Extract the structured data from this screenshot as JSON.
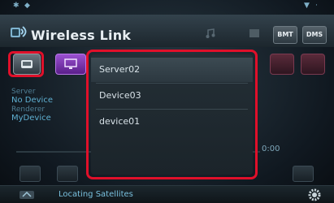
{
  "header": {
    "title": "Wireless Link",
    "btn_bmt": "BMT",
    "btn_dms": "DMS"
  },
  "info": {
    "server_label": "Server",
    "server_value": "No Device",
    "renderer_label": "Renderer",
    "renderer_value": "MyDevice"
  },
  "playback": {
    "time_right": "0:00"
  },
  "device_list": {
    "items": [
      {
        "label": "Server02"
      },
      {
        "label": "Device03"
      },
      {
        "label": "device01"
      }
    ]
  },
  "status_bar": {
    "message": "Locating Satellites"
  },
  "colors": {
    "highlight": "#e0102a",
    "accent_purple": "#9a50d0",
    "text_blue": "#5fb0d2"
  },
  "icons": {
    "app": "wireless-link-icon",
    "device_tab": "device-icon",
    "screen_tab": "monitor-icon",
    "settings": "gear-icon",
    "bottom_left": "navigation-icon"
  }
}
